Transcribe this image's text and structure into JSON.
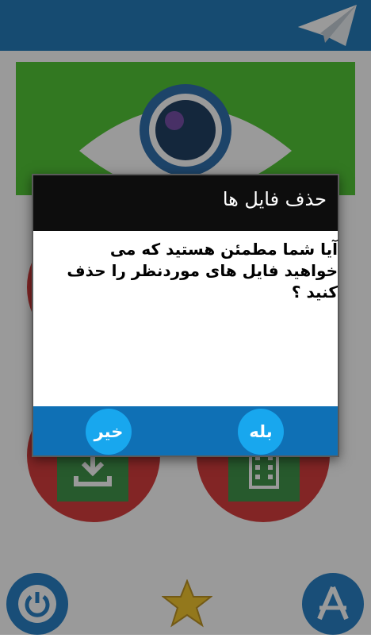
{
  "app": {
    "icons": {
      "logo": "paper-plane-icon",
      "power": "power-icon",
      "favorite": "star-icon",
      "store": "app-store-icon",
      "banner": "eye-icon",
      "download": "download-icon",
      "video": "film-icon"
    },
    "colors": {
      "topbar": "#0f6fb4",
      "banner": "#43c223",
      "circle": "#d42b2b",
      "tile": "#2f8a3a",
      "footer": "#0f70b5",
      "choice_button": "#18a7ee"
    }
  },
  "dialog": {
    "title": "حذف فایل ها",
    "message": "آیا شما مطمئن هستید که می خواهید فایل های موردنظر را حذف کنید ؟",
    "no_label": "خیر",
    "yes_label": "بله"
  }
}
